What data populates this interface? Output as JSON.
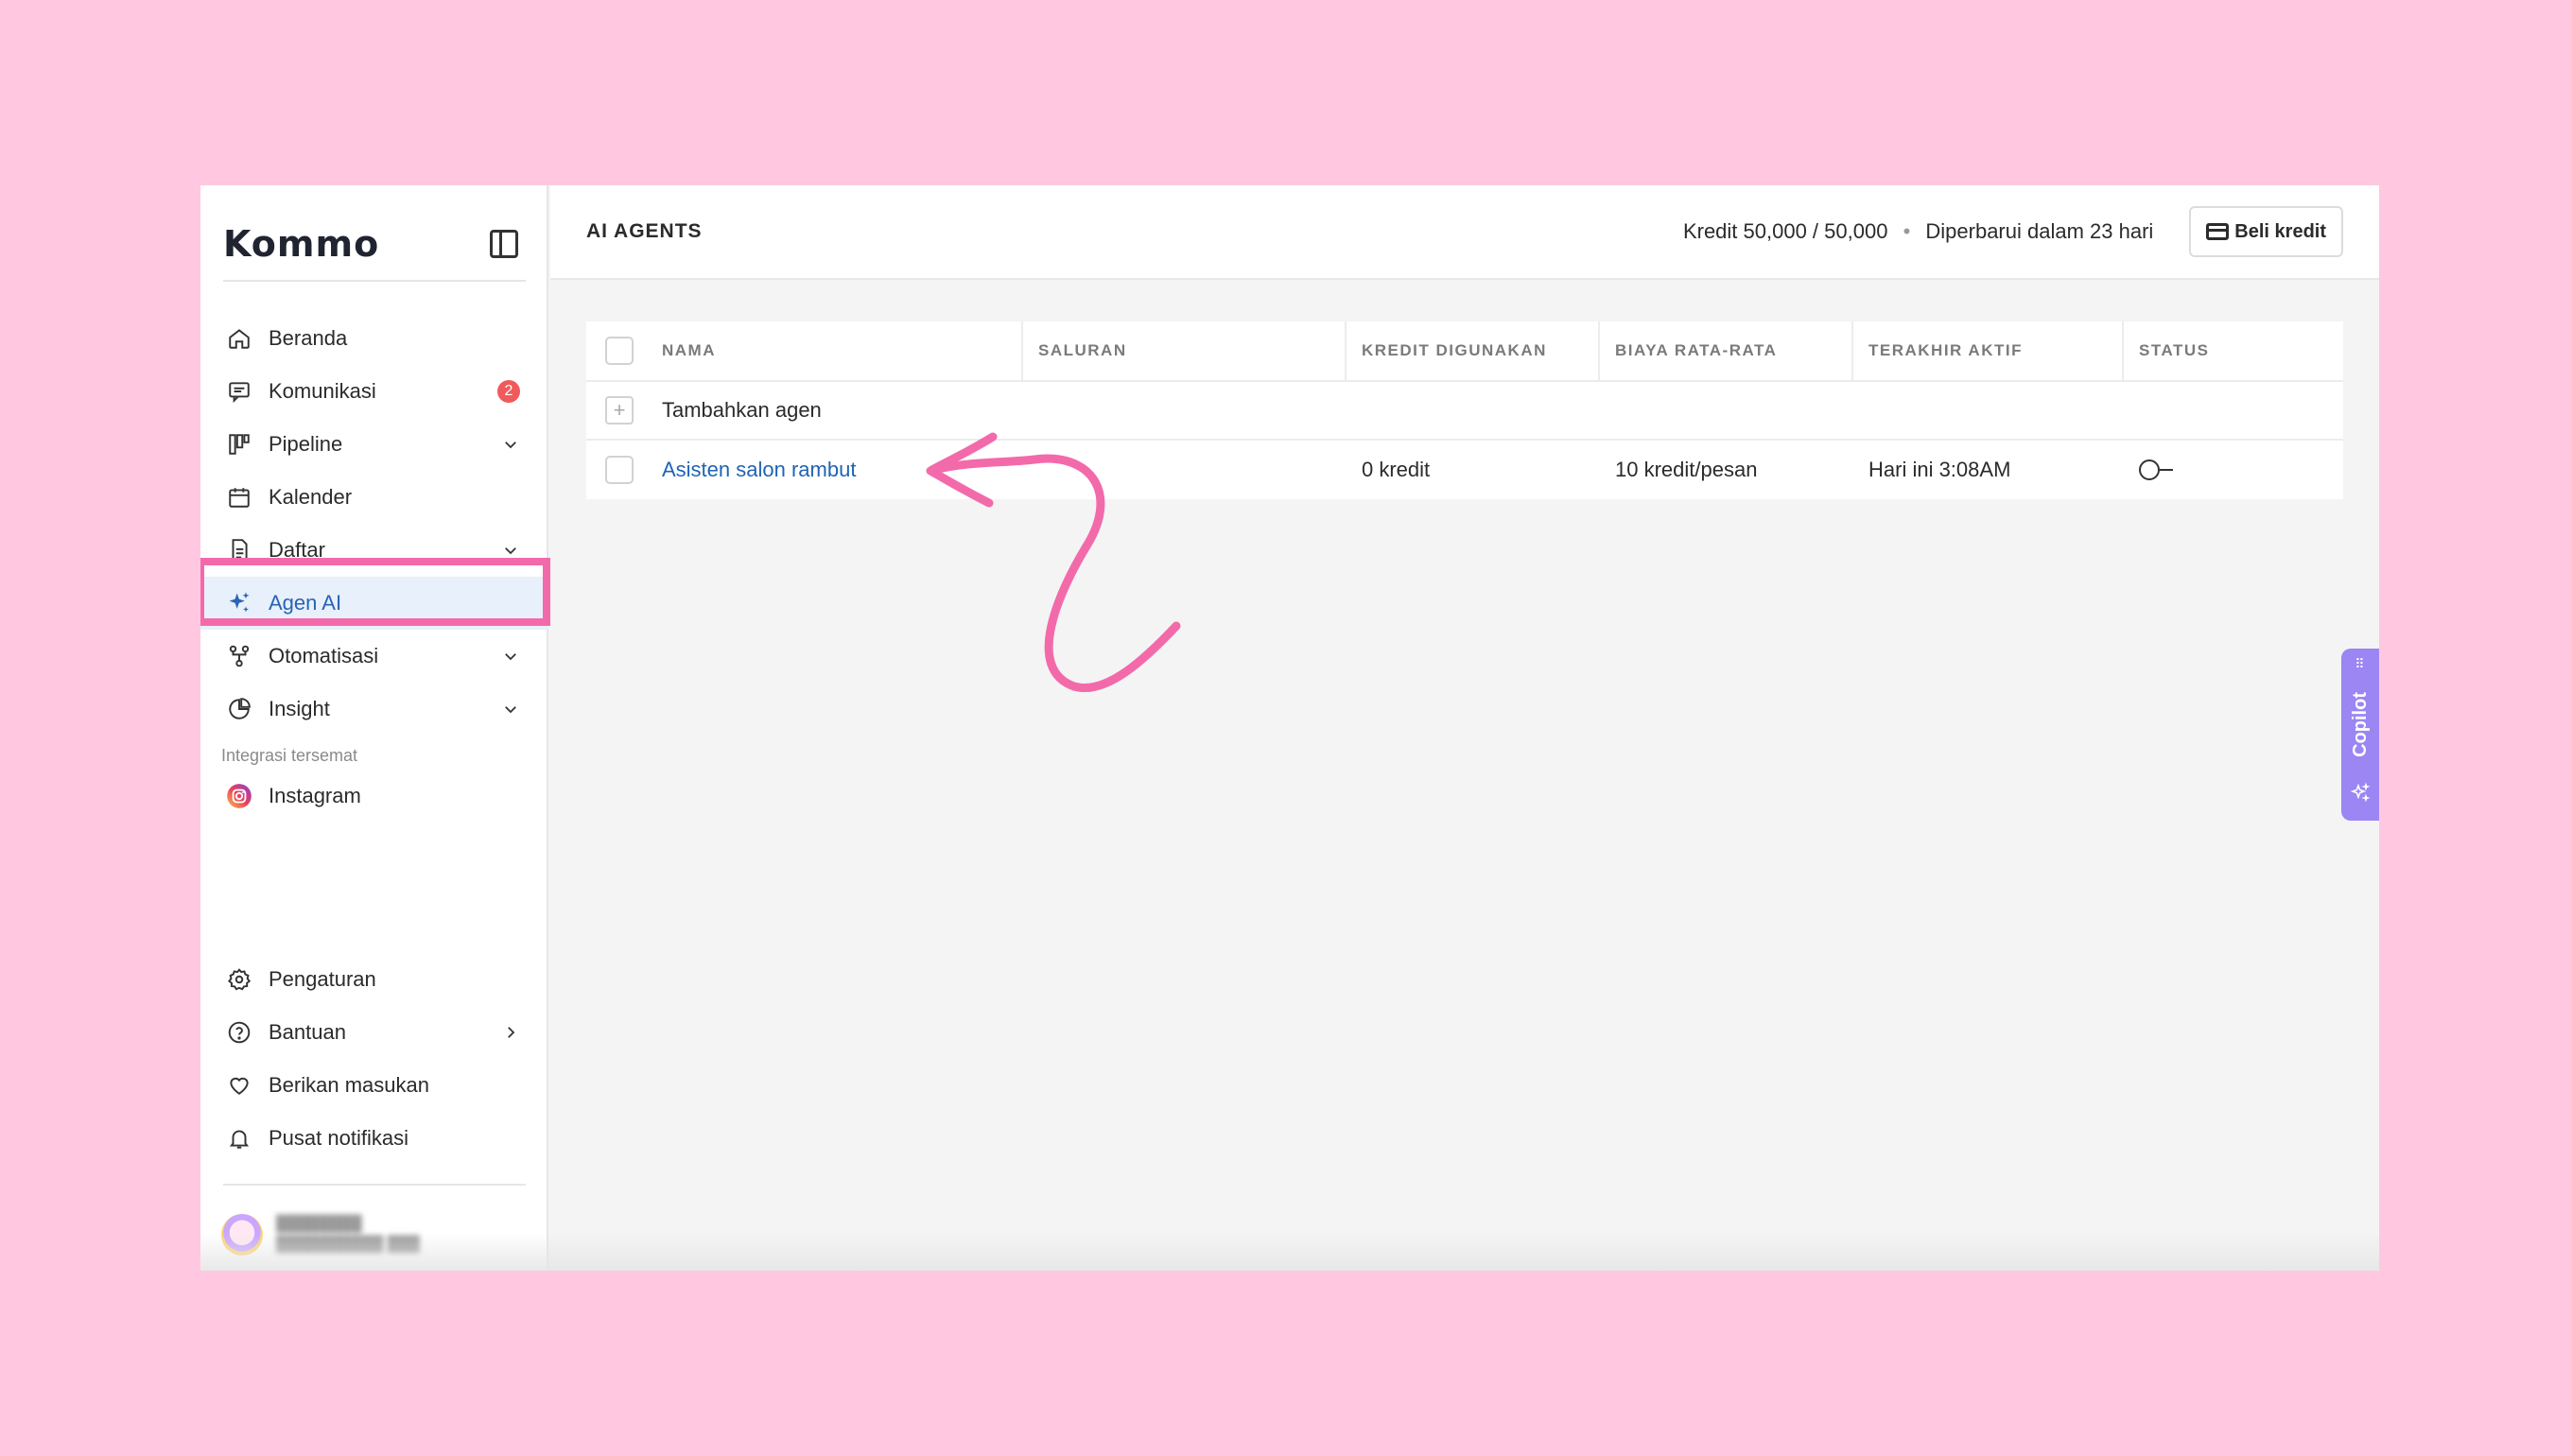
{
  "brand": {
    "name": "Kommo"
  },
  "sidebar": {
    "items": [
      {
        "label": "Beranda",
        "icon": "home-icon"
      },
      {
        "label": "Komunikasi",
        "icon": "chat-icon",
        "badge": "2"
      },
      {
        "label": "Pipeline",
        "icon": "pipeline-icon",
        "expandable": true
      },
      {
        "label": "Kalender",
        "icon": "calendar-icon"
      },
      {
        "label": "Daftar",
        "icon": "document-icon",
        "expandable": true
      },
      {
        "label": "Agen AI",
        "icon": "sparkle-icon",
        "active": true
      },
      {
        "label": "Otomatisasi",
        "icon": "automation-icon",
        "expandable": true
      },
      {
        "label": "Insight",
        "icon": "pie-chart-icon",
        "expandable": true
      }
    ],
    "pinned_section_label": "Integrasi tersemat",
    "pinned": [
      {
        "label": "Instagram",
        "icon": "instagram-icon"
      }
    ],
    "bottom_items": [
      {
        "label": "Pengaturan",
        "icon": "gear-icon"
      },
      {
        "label": "Bantuan",
        "icon": "help-icon"
      },
      {
        "label": "Berikan masukan",
        "icon": "heart-icon"
      },
      {
        "label": "Pusat notifikasi",
        "icon": "bell-icon"
      }
    ]
  },
  "header": {
    "title": "AI AGENTS",
    "credit": "Kredit 50,000 / 50,000",
    "separator": "•",
    "renewal": "Diperbarui dalam 23 hari",
    "buy_button": "Beli kredit"
  },
  "table": {
    "columns": [
      "NAMA",
      "SALURAN",
      "KREDIT DIGUNAKAN",
      "BIAYA RATA-RATA",
      "TERAKHIR AKTIF",
      "STATUS"
    ],
    "add_label": "Tambahkan agen",
    "add_symbol": "+",
    "rows": [
      {
        "name": "Asisten salon rambut",
        "channel": "",
        "credits_used": "0 kredit",
        "avg_cost": "10 kredit/pesan",
        "last_active": "Hari ini 3:08AM",
        "status": "off"
      }
    ]
  },
  "copilot": {
    "label": "Copilot"
  },
  "colors": {
    "background": "#ffc8e0",
    "highlight": "#f36aaa",
    "accent": "#2a63b5",
    "copilot": "#9b86f3",
    "badge": "#f05a5a"
  }
}
